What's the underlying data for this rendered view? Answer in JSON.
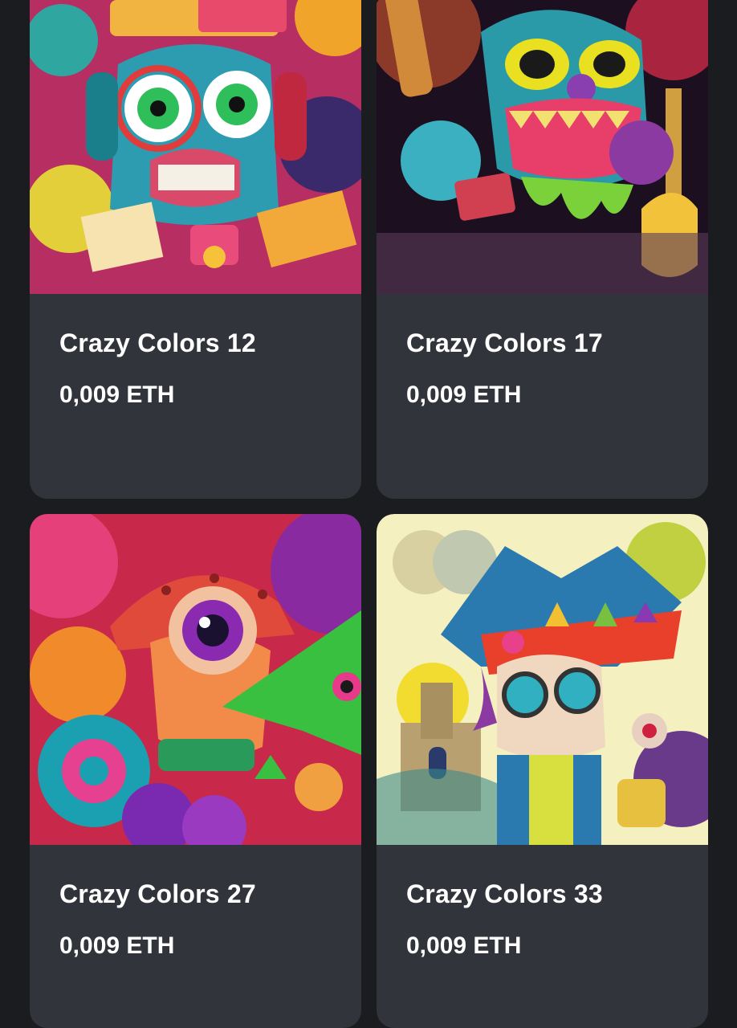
{
  "nft_grid": {
    "items": [
      {
        "name": "Crazy Colors 12",
        "price": "0,009 ETH"
      },
      {
        "name": "Crazy Colors 17",
        "price": "0,009 ETH"
      },
      {
        "name": "Crazy Colors 27",
        "price": "0,009 ETH"
      },
      {
        "name": "Crazy Colors 33",
        "price": "0,009 ETH"
      }
    ]
  },
  "colors": {
    "background": "#1b1c1f",
    "card": "#32343b",
    "text": "#ffffff"
  }
}
